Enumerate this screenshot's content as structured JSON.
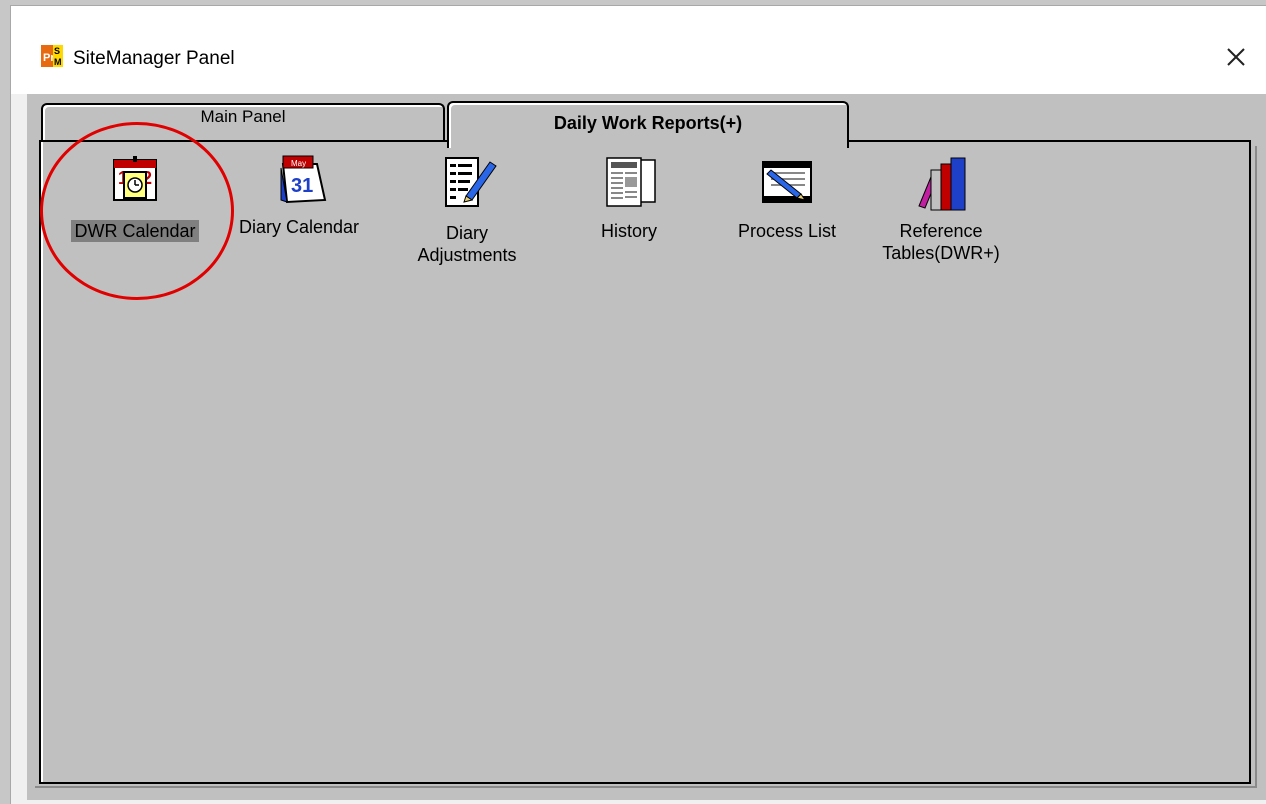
{
  "window": {
    "title": "SiteManager Panel",
    "app_icon": "sitemanager-logo",
    "close_glyph": "✕"
  },
  "tabs": [
    {
      "label": "Main Panel",
      "active": false
    },
    {
      "label": "Daily Work Reports(+)",
      "active": true
    }
  ],
  "items": [
    {
      "label": "DWR Calendar",
      "icon": "calendar-clock-icon",
      "selected": true
    },
    {
      "label": "Diary Calendar",
      "icon": "desk-calendar-icon",
      "calendar_text": "31",
      "calendar_month": "May"
    },
    {
      "label_line1": "Diary",
      "label_line2": "Adjustments",
      "icon": "document-pencil-icon"
    },
    {
      "label": "History",
      "icon": "newspaper-icon"
    },
    {
      "label": "Process List",
      "icon": "process-window-icon"
    },
    {
      "label_line1": "Reference",
      "label_line2": "Tables(DWR+)",
      "icon": "books-icon"
    }
  ],
  "annotation": {
    "color": "#e00000"
  }
}
